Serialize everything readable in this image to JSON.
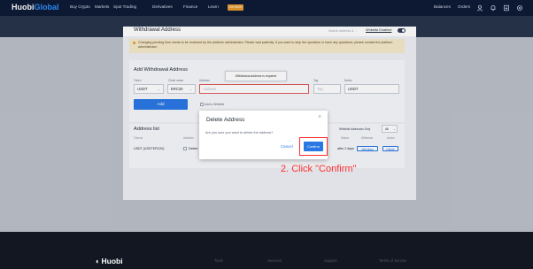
{
  "topnav": {
    "logo_main": "Huobi",
    "logo_accent": "Global",
    "items": [
      "Buy Crypto",
      "Markets",
      "Spot Trading",
      "Derivatives",
      "Finance",
      "Learn"
    ],
    "get_tag": "Get $10K",
    "right": [
      "Balances",
      "Orders"
    ]
  },
  "page": {
    "title": "Withdrawal Address",
    "search_hint": "Search address & ...",
    "whitelist_label": "Whitelist Enabled"
  },
  "notice": {
    "text": "Changing pending time needs to be reviewed by the platform administrator. Please wait patiently. If you want to stop the operation or have any questions, please contact the platform administrator."
  },
  "add_form": {
    "heading": "Add Withdrawal Address",
    "labels": {
      "token": "Token",
      "chain": "Chain name",
      "address": "Address",
      "tag": "Tag",
      "notes": "Notes"
    },
    "token_value": "USDT",
    "chain_value": "ERC20",
    "address_placeholder": "Address",
    "tag_placeholder": "Tag",
    "notes_value": "USDT",
    "tooltip": "Withdrawal address is required",
    "add_button": "Add",
    "whitelist_checkbox": "Add to Whitelist"
  },
  "address_list": {
    "heading": "Address list",
    "filter_label": "Whitelist Addresses Only",
    "filter_value": "All",
    "headers": [
      "Tokens",
      "Address",
      "Status",
      "Withdraw",
      "Action"
    ],
    "row": {
      "token": "USDT (USDTERC20)",
      "address": "Delete",
      "status": "after 2 days",
      "withdraw": "Withdraw",
      "action": "Delete"
    }
  },
  "modal": {
    "title": "Delete Address",
    "close": "×",
    "body": "Are you sure you want to delete the address?",
    "cancel": "Cancel",
    "confirm": "Confirm"
  },
  "annotation": {
    "callout": "2. Click \"Confirm\""
  },
  "footer": {
    "logo": "Huobi",
    "links": [
      "Tools",
      "Services",
      "Support",
      "Terms of Service"
    ]
  }
}
